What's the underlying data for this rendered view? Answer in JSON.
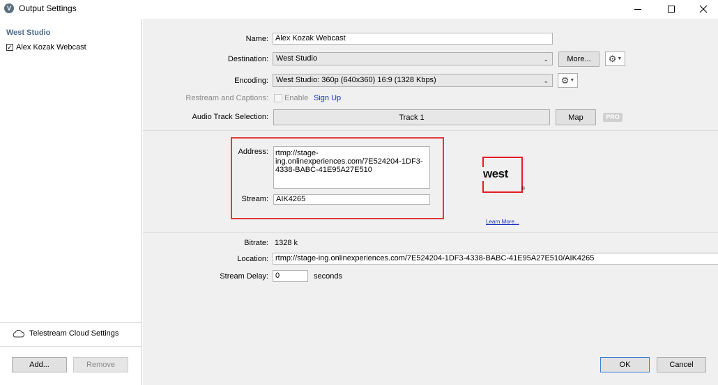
{
  "window": {
    "title": "Output Settings",
    "app_icon_letter": "V"
  },
  "sidebar": {
    "studio_title": "West Studio",
    "items": [
      {
        "label": "Alex Kozak Webcast",
        "checked": true,
        "check_glyph": "✓"
      }
    ],
    "cloud_settings_label": "Telestream Cloud Settings",
    "add_label": "Add...",
    "remove_label": "Remove"
  },
  "form": {
    "name_label": "Name:",
    "name_value": "Alex Kozak Webcast",
    "destination_label": "Destination:",
    "destination_value": "West Studio",
    "more_label": "More...",
    "encoding_label": "Encoding:",
    "encoding_value": "West Studio: 360p (640x360) 16:9 (1328 Kbps)",
    "restream_label": "Restream and Captions:",
    "enable_label": "Enable",
    "signup_label": "Sign Up",
    "audio_label": "Audio Track Selection:",
    "audio_value": "Track 1",
    "map_label": "Map",
    "pro_label": "PRO"
  },
  "stream": {
    "address_label": "Address:",
    "address_value": "rtmp://stage-\ning.onlinexperiences.com/7E524204-1DF3-\n4338-BABC-41E95A27E510",
    "stream_label": "Stream:",
    "stream_value": "AIK4265",
    "logo_text": "west",
    "logo_reg": "®",
    "learn_more": "Learn More..."
  },
  "info": {
    "bitrate_label": "Bitrate:",
    "bitrate_value": "1328 k",
    "location_label": "Location:",
    "location_value": "rtmp://stage-ing.onlinexperiences.com/7E524204-1DF3-4338-BABC-41E95A27E510/AIK4265",
    "delay_label": "Stream Delay:",
    "delay_value": "0",
    "delay_unit": "seconds"
  },
  "footer": {
    "ok_label": "OK",
    "cancel_label": "Cancel"
  },
  "colors": {
    "highlight": "#e03a3a",
    "brand_red": "#e31b23",
    "link": "#1a2fbf",
    "studio_title": "#4a6a8a"
  },
  "icons": [
    "app-logo-icon",
    "minimize-icon",
    "maximize-icon",
    "close-icon",
    "check-icon",
    "cloud-icon",
    "gear-icon",
    "chevron-down-icon"
  ]
}
